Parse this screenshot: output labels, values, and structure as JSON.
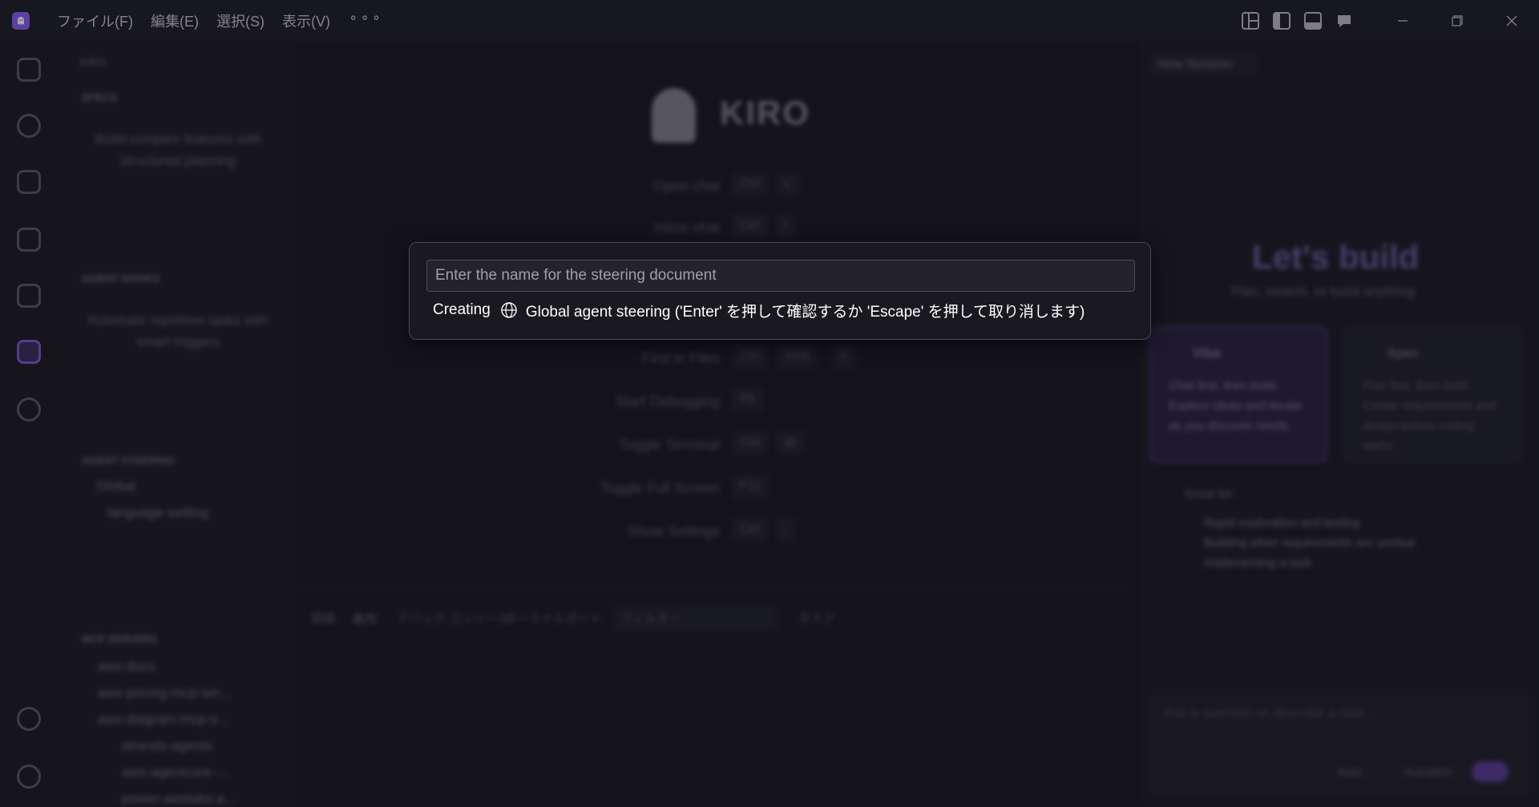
{
  "menu": {
    "file": "ファイル(F)",
    "edit": "編集(E)",
    "selection": "選択(S)",
    "view": "表示(V)",
    "more": "⚬⚬⚬"
  },
  "sidebar": {
    "title": "KIRO",
    "specs_header": "SPECS",
    "specs_desc": "Build complex features with structured planning",
    "hooks_header": "AGENT HOOKS",
    "hooks_desc": "Automate repetitive tasks with smart triggers",
    "steering_header": "AGENT STEERING",
    "steering_global": "Global",
    "steering_item": "language-setting",
    "mcp_header": "MCP SERVERS",
    "mcp_items": [
      "aws-docs",
      "aws-pricing-mcp-ser...",
      "aws-diagram-mcp-s...",
      "strands-agents",
      "aws-agentcore-...",
      "power-awslabs.a..."
    ]
  },
  "editor": {
    "brand": "KIRO",
    "shortcuts": [
      {
        "label": "Open chat",
        "keys": [
          "Ctrl",
          "L"
        ]
      },
      {
        "label": "Inline chat",
        "keys": [
          "Ctrl",
          "I"
        ]
      },
      {
        "label": "Find in Files",
        "keys": [
          "Ctrl",
          "Shift",
          "F"
        ]
      },
      {
        "label": "Start Debugging",
        "keys": [
          "F5"
        ]
      },
      {
        "label": "Toggle Terminal",
        "keys": [
          "Ctrl",
          "@"
        ]
      },
      {
        "label": "Toggle Full Screen",
        "keys": [
          "F11"
        ]
      },
      {
        "label": "Show Settings",
        "keys": [
          "Ctrl",
          ","
        ]
      }
    ]
  },
  "panel": {
    "tabs": [
      "問題",
      "出力",
      "デバッグ コンソール",
      "ターミナル",
      "ポート"
    ],
    "filter_placeholder": "フィルター",
    "task_select": "タスク"
  },
  "chat": {
    "tab": "New Session",
    "heading": "Let's build",
    "subheading": "Plan, search, or build anything",
    "vibe_title": "Vibe",
    "vibe_desc": "Chat first, then build. Explore ideas and iterate as you discover needs.",
    "spec_title": "Spec",
    "spec_desc": "Plan first, then build. Create requirements and design before coding starts.",
    "great_for": "Great for:",
    "bullets": [
      "Rapid exploration and testing",
      "Building when requirements are unclear",
      "Implementing a task"
    ],
    "input_placeholder": "Ask a question or describe a task...",
    "mode": "Auto",
    "autopilot": "Autopilot"
  },
  "quick_input": {
    "placeholder": "Enter the name for the steering document",
    "value": "",
    "creating": "Creating",
    "message": "Global agent steering ('Enter' を押して確認するか 'Escape' を押して取り消します)"
  },
  "colors": {
    "accent": "#8b5cf6",
    "background": "#1b1a22"
  }
}
